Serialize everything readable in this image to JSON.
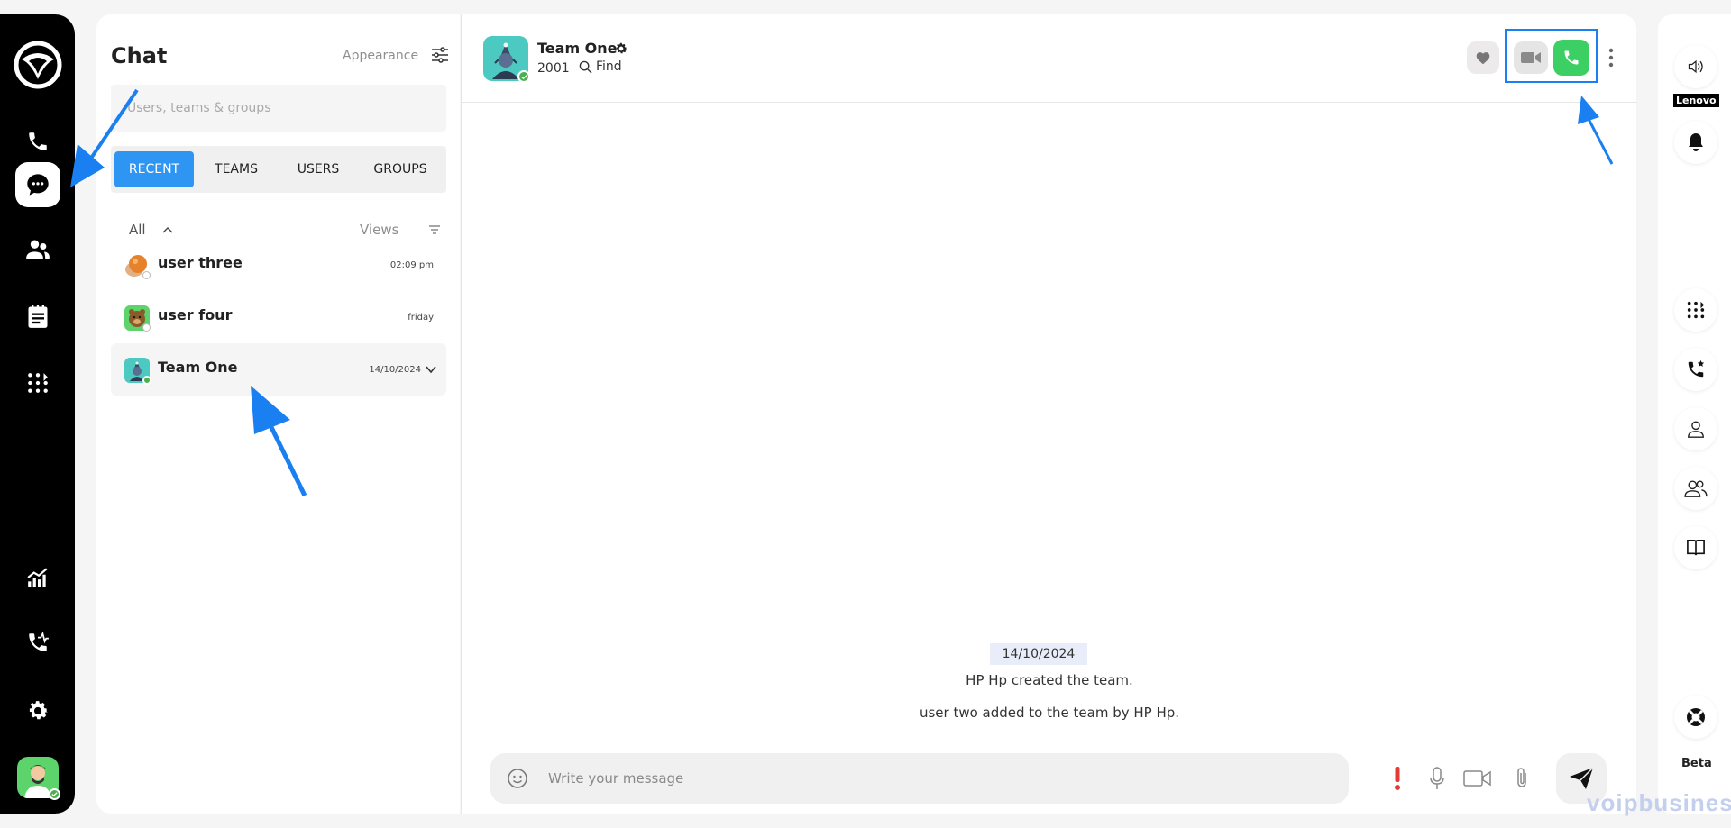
{
  "rail": {
    "items": [
      "phone-icon",
      "chat-icon",
      "users-icon",
      "notes-icon",
      "dialpad-icon",
      "stats-icon",
      "call-activity-icon",
      "settings-icon"
    ],
    "active": "chat-icon"
  },
  "list": {
    "title": "Chat",
    "appearance_label": "Appearance",
    "search_placeholder": "Users, teams & groups",
    "tabs": [
      {
        "label": "RECENT",
        "active": true
      },
      {
        "label": "TEAMS",
        "active": false
      },
      {
        "label": "USERS",
        "active": false
      },
      {
        "label": "GROUPS",
        "active": false
      }
    ],
    "filter_label": "All",
    "views_label": "Views",
    "conversations": [
      {
        "name": "user three",
        "time": "02:09 pm",
        "selected": false
      },
      {
        "name": "user four",
        "time": "friday",
        "selected": false
      },
      {
        "name": "Team One",
        "time": "14/10/2024",
        "selected": true
      }
    ]
  },
  "header": {
    "name": "Team One",
    "extension": "2001",
    "find_label": "Find"
  },
  "messages": {
    "date_chip": "14/10/2024",
    "system": [
      "HP Hp created the team.",
      "user two added to the team by HP Hp."
    ]
  },
  "composer": {
    "placeholder": "Write your message"
  },
  "rightbar": {
    "device_label": "Lenovo",
    "beta_label": "Beta"
  },
  "watermark": "voipbusiness",
  "colors": {
    "accent_blue": "#2f95f3",
    "call_green": "#3ccf63",
    "annotation_blue": "#1a7ff0"
  }
}
